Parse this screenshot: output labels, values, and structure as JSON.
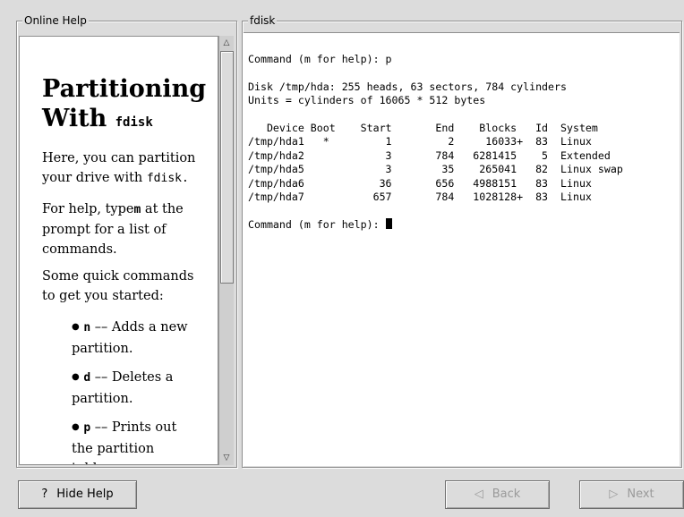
{
  "help_panel": {
    "title": "Online Help",
    "heading_line1": "Partitioning",
    "heading_line2": "With",
    "heading_cmd": "fdisk",
    "para1_text": "Here, you can partition your drive with",
    "para1_cmd": "fdisk.",
    "para2_before": "For help, type",
    "para2_key": "m",
    "para2_after": "at the prompt for a list of commands.",
    "para3": "Some quick commands to get you started:",
    "items": [
      {
        "key": "n",
        "text": "–– Adds a new partition."
      },
      {
        "key": "d",
        "text": "–– Deletes a partition."
      },
      {
        "key": "p",
        "text": "–– Prints out the partition table."
      }
    ]
  },
  "fdisk_panel": {
    "title": "fdisk",
    "terminal_text": "Command (m for help): p\n\nDisk /tmp/hda: 255 heads, 63 sectors, 784 cylinders\nUnits = cylinders of 16065 * 512 bytes\n\n   Device Boot    Start       End    Blocks   Id  System\n/tmp/hda1   *         1         2     16033+  83  Linux\n/tmp/hda2             3       784   6281415    5  Extended\n/tmp/hda5             3        35    265041   82  Linux swap\n/tmp/hda6            36       656   4988151   83  Linux\n/tmp/hda7           657       784   1028128+  83  Linux\n\nCommand (m for help): "
  },
  "buttons": {
    "hide_help": "Hide Help",
    "back": "Back",
    "next": "Next"
  },
  "icons": {
    "hide_help": "question-icon",
    "back": "left-arrow-icon",
    "next": "right-arrow-icon"
  }
}
